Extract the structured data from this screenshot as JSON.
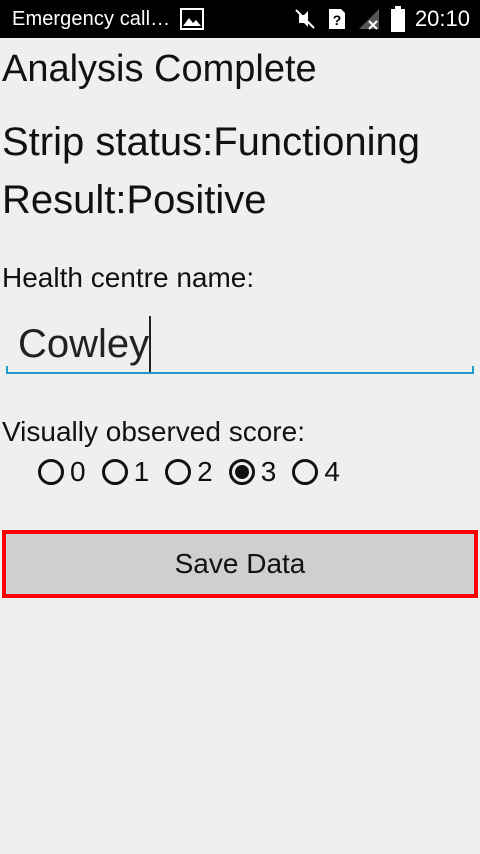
{
  "status_bar": {
    "title": "Emergency call…",
    "time": "20:10",
    "icons": [
      "image-icon",
      "mute-icon",
      "unknown-sim-icon",
      "signal-icon",
      "battery-icon"
    ]
  },
  "main": {
    "title": "Analysis Complete",
    "strip_status": "Strip status:Functioning",
    "result": "Result:Positive",
    "health_centre_label": "Health centre name:",
    "health_centre_value": "Cowley",
    "score_label": "Visually observed score:",
    "score_options": [
      "0",
      "1",
      "2",
      "3",
      "4"
    ],
    "selected_score": "3",
    "save_label": "Save Data"
  },
  "colors": {
    "status_bg": "#000000",
    "page_bg": "#efefef",
    "input_underline": "#1b9bc6",
    "button_bg": "#cfcfcf",
    "highlight_border": "#ff0000"
  }
}
